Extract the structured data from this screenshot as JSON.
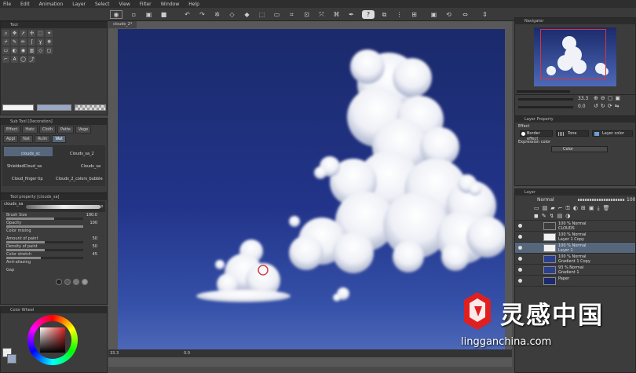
{
  "menu": [
    "File",
    "Edit",
    "Animation",
    "Layer",
    "Select",
    "View",
    "Filter",
    "Window",
    "Help"
  ],
  "canvas_tab": "clouds_2*",
  "left": {
    "tool_tab": "Tool",
    "subtool_title": "Sub Tool [Decoration]",
    "subtool_tabs": [
      "Effect",
      "Hatc",
      "Cloth",
      "Patte",
      "Vege",
      "Appl",
      "Nat",
      "Rulin",
      "Wat"
    ],
    "brushes": [
      "clouds_sc",
      "Clouds_sa_2",
      "ShieldedCloud_sa",
      "Clouds_sa",
      "Cloud_finger tip",
      "Clouds_2_colors_bubble"
    ],
    "toolprop_title": "Tool property [clouds_sa]",
    "toolprop_brush": "clouds_sa",
    "props": [
      {
        "label": "Brush Size",
        "value": "100.0",
        "fill": 0.62
      },
      {
        "label": "Opacity",
        "value": "100",
        "fill": 1.0
      },
      {
        "label": "Color mixing",
        "value": "",
        "fill": 0
      },
      {
        "label": "Amount of paint",
        "value": "50",
        "fill": 0.5
      },
      {
        "label": "Density of paint",
        "value": "50",
        "fill": 0.5
      },
      {
        "label": "Color stretch",
        "value": "45",
        "fill": 0.45
      },
      {
        "label": "Anti-aliasing",
        "value": "",
        "fill": 0
      },
      {
        "label": "Gap",
        "value": "",
        "fill": 0
      }
    ],
    "colorwheel_title": "Color Wheel"
  },
  "right": {
    "navigator_title": "Navigator",
    "zoom_value": "33.3",
    "angle_value": "0.0",
    "layerprop_title": "Layer Property",
    "effect_label": "Effect",
    "border_effect": "Border effect",
    "tone_label": "Tone",
    "layer_color": "Layer color",
    "expression_color_label": "Expression color",
    "expression_color_value": "Color",
    "layer_tab": "Layer",
    "blend_mode": "Normal",
    "opacity_value": "100",
    "layers": [
      {
        "line1": "100 % Normal",
        "line2": "CLOUDS",
        "type": "folder",
        "selected": false
      },
      {
        "line1": "100 % Normal",
        "line2": "Layer 1 Copy",
        "type": "layer",
        "selected": false
      },
      {
        "line1": "100 % Normal",
        "line2": "Layer 1",
        "type": "layer",
        "selected": true
      },
      {
        "line1": "100 % Normal",
        "line2": "Gradient 1 Copy",
        "type": "gradient",
        "selected": false
      },
      {
        "line1": "93 % Normal",
        "line2": "Gradient 1",
        "type": "gradient",
        "selected": false
      },
      {
        "line1": "",
        "line2": "Paper",
        "type": "paper",
        "selected": false
      }
    ]
  },
  "status": {
    "zoom": "33.3",
    "angle": "0.0"
  },
  "watermark": {
    "text": "灵感中国",
    "url": "lingganchina.com"
  },
  "colors": {
    "sky_top": "#1b2a6b",
    "sky_bottom": "#4e69b8",
    "selected_layer": "#56677c",
    "watermark_red": "#e02020"
  }
}
